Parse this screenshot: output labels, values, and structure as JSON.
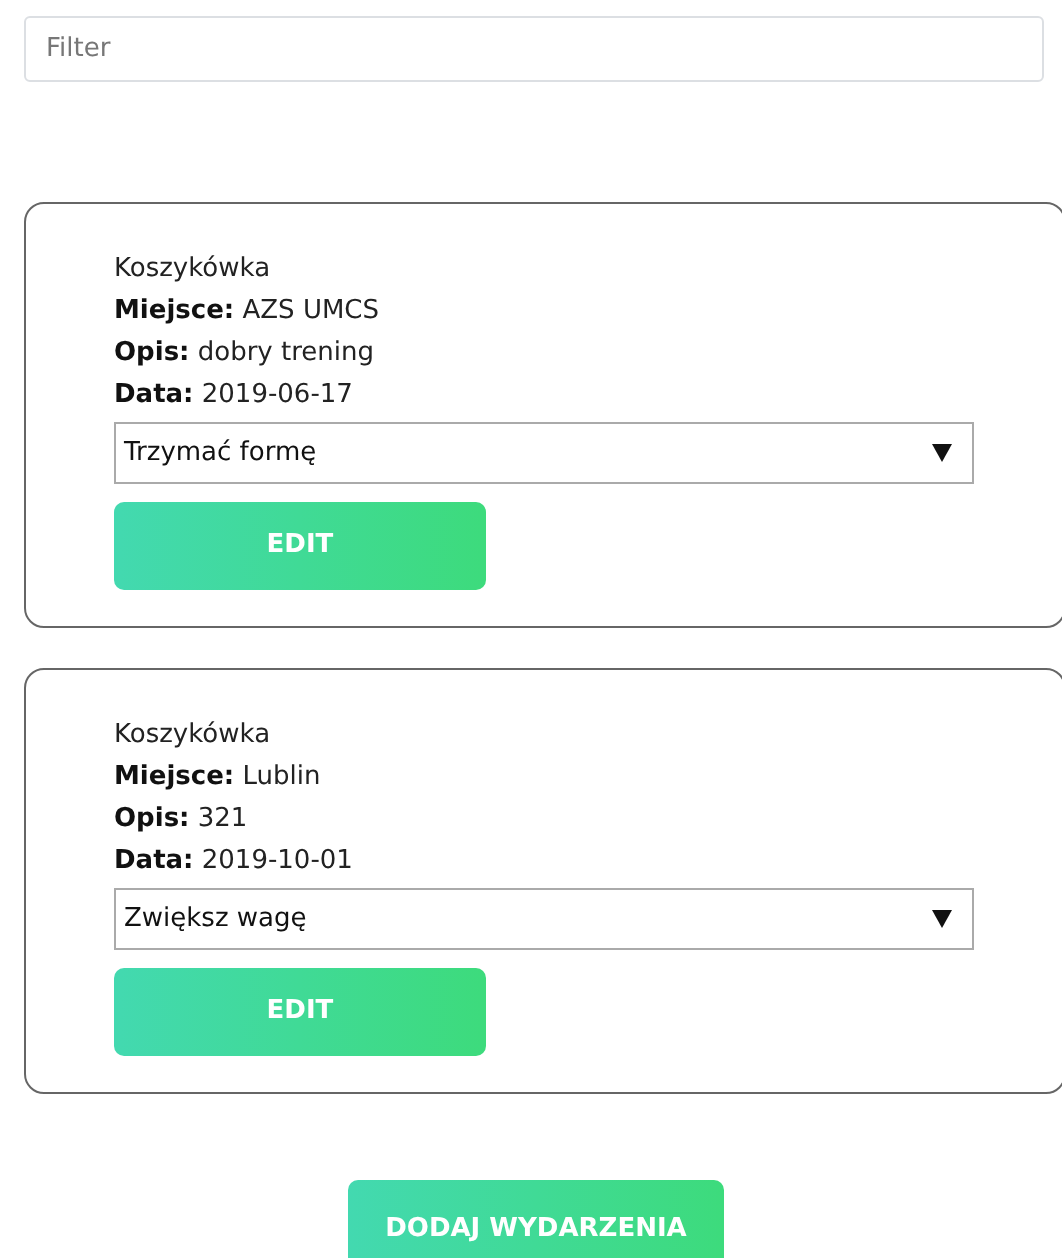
{
  "filter": {
    "placeholder": "Filter"
  },
  "events": [
    {
      "title": "Koszykówka",
      "place": "**Miejsce:** AZS UMCS",
      "description": "**Opis:** dobry trening",
      "date": "**Data:** 2019-06-17",
      "goal": "Trzymać formę",
      "button": "EDIT"
    },
    {
      "title": "Koszykówka",
      "place": "**Miejsce:** Lublin",
      "description": "**Opis:** 321",
      "date": "**Data:** 2019-10-01",
      "goal": "Zwiększ wagę",
      "button": "EDIT"
    }
  ],
  "add_button": "DODAJ WYDARZENIA"
}
